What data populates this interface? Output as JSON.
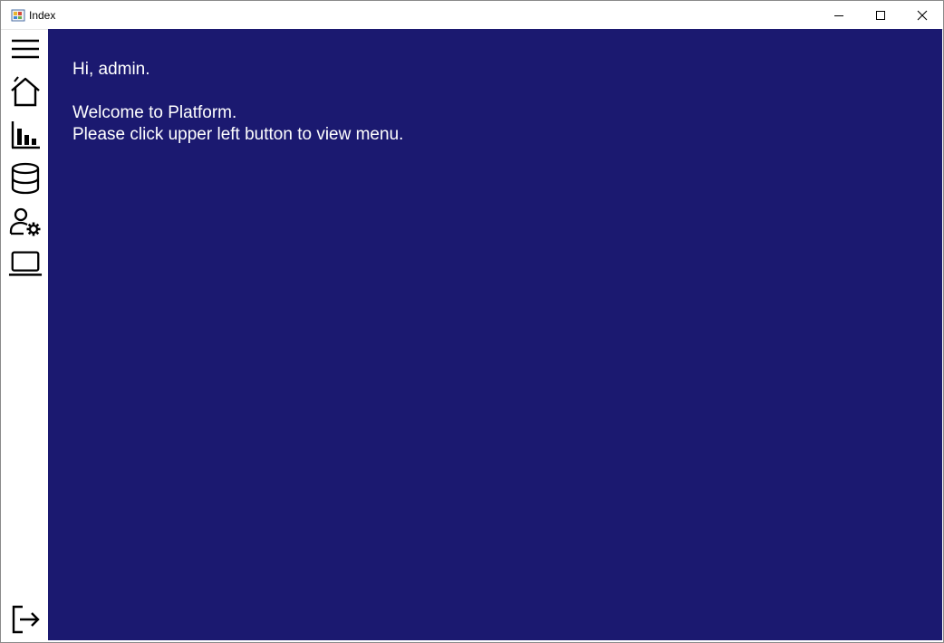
{
  "window": {
    "title": "Index",
    "controls": {
      "minimize_icon": "minimize-icon",
      "maximize_icon": "maximize-icon",
      "close_icon": "close-icon"
    }
  },
  "sidebar": {
    "items": [
      {
        "icon": "hamburger-menu-icon"
      },
      {
        "icon": "home-icon"
      },
      {
        "icon": "bar-chart-icon"
      },
      {
        "icon": "database-icon"
      },
      {
        "icon": "user-settings-icon"
      },
      {
        "icon": "laptop-icon"
      }
    ],
    "bottom_item": {
      "icon": "sign-out-icon"
    }
  },
  "main": {
    "greeting": "Hi, admin.",
    "welcome": "Welcome to Platform.",
    "instruction": "Please click upper left button to view menu."
  },
  "colors": {
    "content_background": "#1b1970",
    "content_text": "#ffffff",
    "sidebar_background": "#ffffff",
    "icon_color": "#000000"
  }
}
